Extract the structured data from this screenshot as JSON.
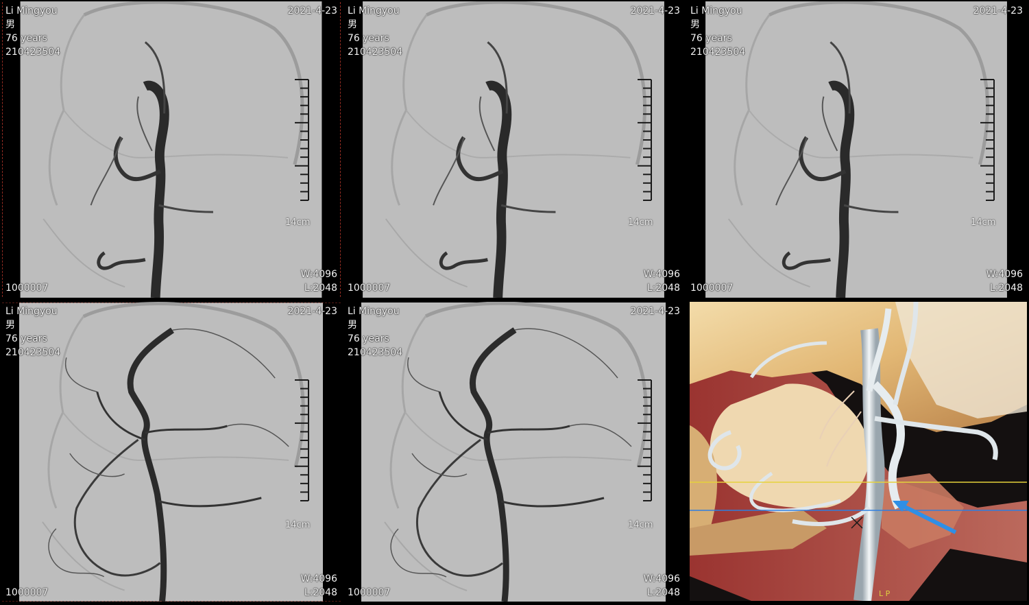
{
  "viewports": [
    {
      "name": "Li Mingyou",
      "sex": "男",
      "age": "76 years",
      "patient_id": "210423504",
      "date": "2021-4-23",
      "image_no": "1000007",
      "window": "W:4096",
      "level": "L:2048",
      "scale": "14cm",
      "selected": true
    },
    {
      "name": "Li Mingyou",
      "sex": "男",
      "age": "76 years",
      "patient_id": "210423504",
      "date": "2021-4-23",
      "image_no": "1000007",
      "window": "W:4096",
      "level": "L:2048",
      "scale": "14cm",
      "selected": false
    },
    {
      "name": "Li Mingyou",
      "sex": "男",
      "age": "76 years",
      "patient_id": "210423504",
      "date": "2021-4-23",
      "image_no": "1000007",
      "window": "W:4096",
      "level": "L:2048",
      "scale": "14cm",
      "selected": false
    },
    {
      "name": "Li Mingyou",
      "sex": "男",
      "age": "76 years",
      "patient_id": "210423504",
      "date": "2021-4-23",
      "image_no": "1000007",
      "window": "W:4096",
      "level": "L:2048",
      "scale": "14cm",
      "selected": true
    },
    {
      "name": "Li Mingyou",
      "sex": "男",
      "age": "76 years",
      "patient_id": "210423504",
      "date": "2021-4-23",
      "image_no": "1000007",
      "window": "W:4096",
      "level": "L:2048",
      "scale": "14cm",
      "selected": false
    }
  ],
  "volume_render": {
    "orientation_label": "L P",
    "colors": {
      "bone": "#e8c98a",
      "vessel": "#dfe6ea",
      "tissue": "#c8483c",
      "line_yellow": "#e6d23a",
      "line_blue": "#2f7fe0",
      "arrow": "#2f8fe6"
    }
  }
}
